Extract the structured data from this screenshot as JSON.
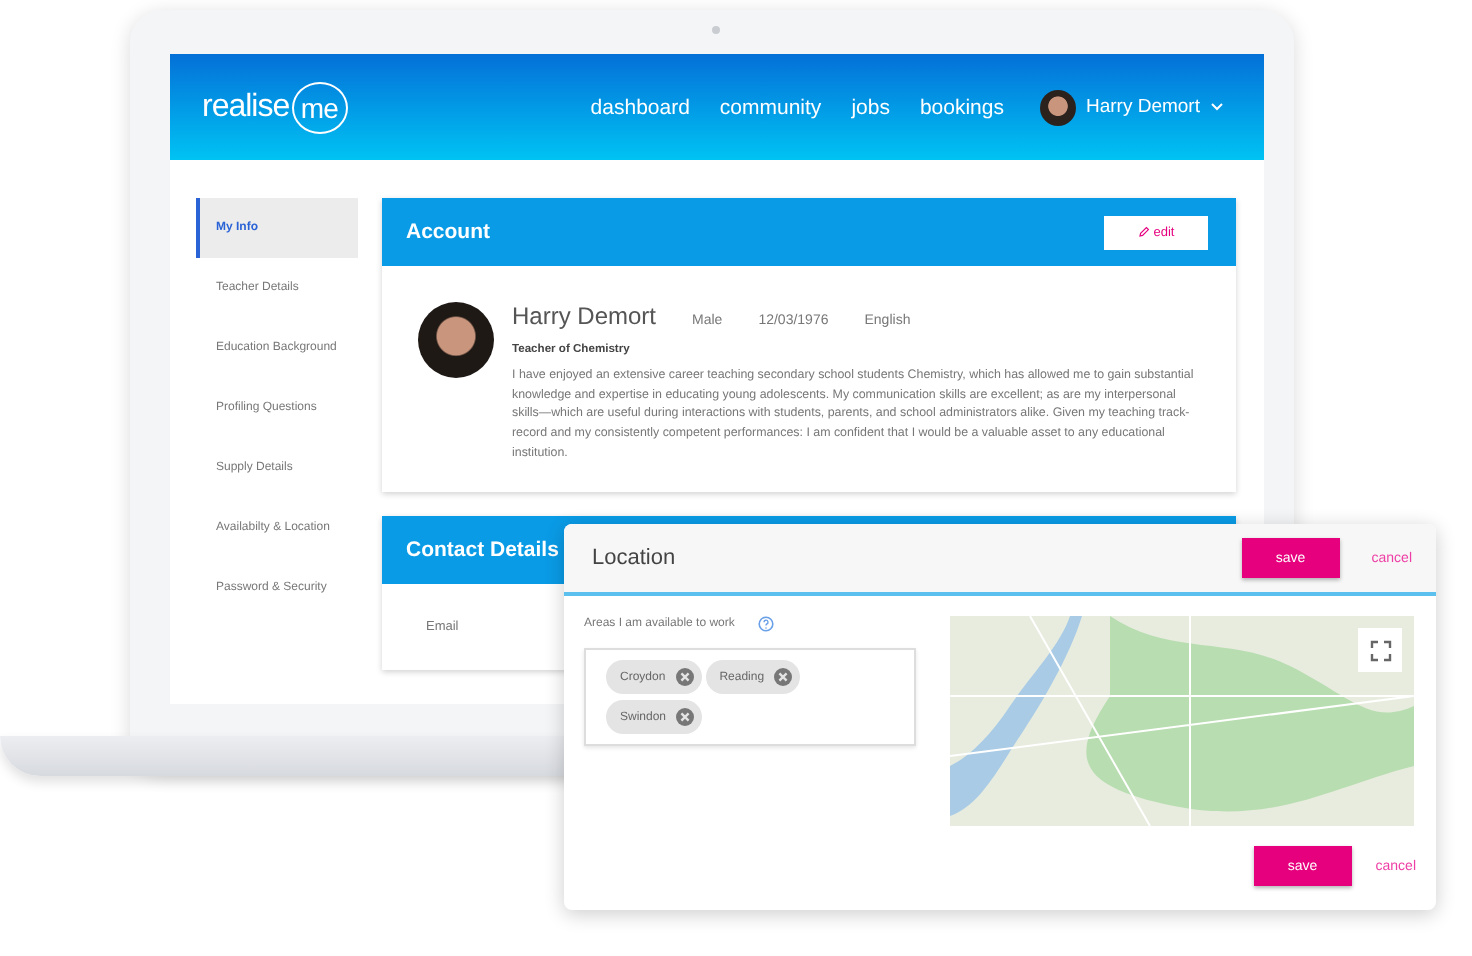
{
  "header": {
    "logo": {
      "text": "realise",
      "circled": "me"
    },
    "nav": [
      {
        "label": "dashboard"
      },
      {
        "label": "community"
      },
      {
        "label": "jobs"
      },
      {
        "label": "bookings"
      }
    ],
    "user": {
      "name": "Harry Demort"
    }
  },
  "sidebar": {
    "items": [
      {
        "label": "My Info",
        "selected": true
      },
      {
        "label": "Teacher Details",
        "selected": false
      },
      {
        "label": "Education Background",
        "selected": false
      },
      {
        "label": "Profiling Questions",
        "selected": false
      },
      {
        "label": "Supply Details",
        "selected": false
      },
      {
        "label": "Availabilty & Location",
        "selected": false
      },
      {
        "label": "Password & Security",
        "selected": false
      }
    ]
  },
  "account": {
    "title": "Account",
    "edit_button": "edit",
    "name": "Harry Demort",
    "gender": "Male",
    "dob": "12/03/1976",
    "language": "English",
    "role": "Teacher of Chemistry",
    "bio": "I have enjoyed an extensive career teaching secondary school students Chemistry, which has allowed me to gain substantial knowledge and expertise in educating young adolescents. My communication skills are excellent; as are my interpersonal skills—which are useful during interactions with students, parents, and school administrators alike. Given my teaching track-record and my consistently competent performances: I am confident that I would be a valuable asset to any educational institution."
  },
  "contact": {
    "title": "Contact Details",
    "fields": [
      {
        "label": "Email"
      }
    ]
  },
  "location_dialog": {
    "title": "Location",
    "save_button": "save",
    "cancel_link": "cancel",
    "areas_label": "Areas I am available to work",
    "tags": [
      {
        "label": "Croydon"
      },
      {
        "label": "Reading"
      },
      {
        "label": "Swindon"
      }
    ],
    "footer_save_button": "save",
    "footer_cancel_link": "cancel"
  }
}
